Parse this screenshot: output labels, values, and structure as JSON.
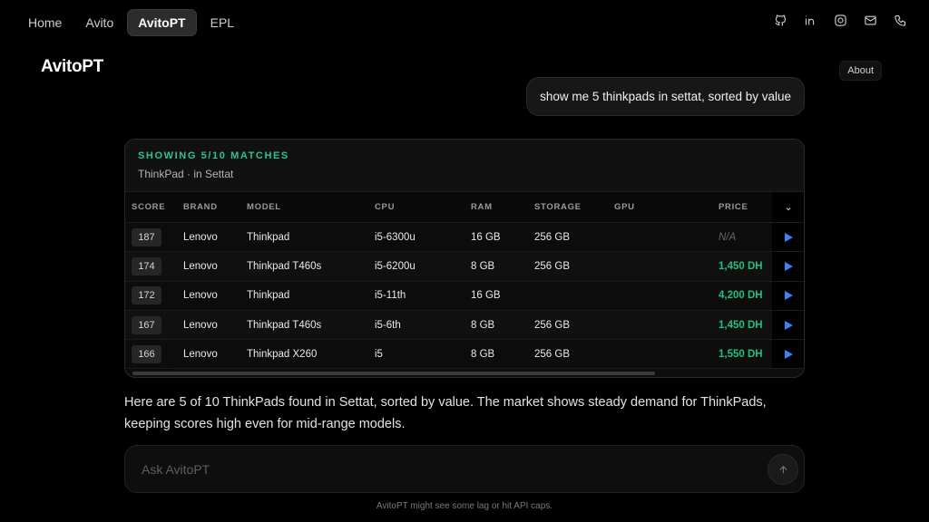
{
  "nav": [
    "Home",
    "Avito",
    "AvitoPT",
    "EPL"
  ],
  "nav_active": 2,
  "socials": [
    "github-icon",
    "linkedin-icon",
    "instagram-icon",
    "mail-icon",
    "phone-icon"
  ],
  "brand": "AvitoPT",
  "about_label": "About",
  "user_message": "show me 5 thinkpads in settat, sorted by value",
  "results": {
    "title": "SHOWING 5/10 MATCHES",
    "subtitle": "ThinkPad · in Settat",
    "columns": [
      "SCORE",
      "BRAND",
      "MODEL",
      "CPU",
      "RAM",
      "STORAGE",
      "GPU",
      "PRICE"
    ],
    "rows": [
      {
        "score": "187",
        "brand": "Lenovo",
        "model": "Thinkpad",
        "cpu": "i5-6300u",
        "ram": "16 GB",
        "storage": "256 GB",
        "gpu": "",
        "price": "N/A"
      },
      {
        "score": "174",
        "brand": "Lenovo",
        "model": "Thinkpad T460s",
        "cpu": "i5-6200u",
        "ram": "8 GB",
        "storage": "256 GB",
        "gpu": "",
        "price": "1,450 DH"
      },
      {
        "score": "172",
        "brand": "Lenovo",
        "model": "Thinkpad",
        "cpu": "i5-11th",
        "ram": "16 GB",
        "storage": "",
        "gpu": "",
        "price": "4,200 DH"
      },
      {
        "score": "167",
        "brand": "Lenovo",
        "model": "Thinkpad T460s",
        "cpu": "i5-6th",
        "ram": "8 GB",
        "storage": "256 GB",
        "gpu": "",
        "price": "1,450 DH"
      },
      {
        "score": "166",
        "brand": "Lenovo",
        "model": "Thinkpad X260",
        "cpu": "i5",
        "ram": "8 GB",
        "storage": "256 GB",
        "gpu": "",
        "price": "1,550 DH"
      }
    ],
    "accent": "#2fc38b",
    "play_color": "#3b82f6"
  },
  "answer": "Here are 5 of 10 ThinkPads found in Settat, sorted by value. The market shows steady demand for ThinkPads, keeping scores high even for mid-range models.",
  "composer": {
    "placeholder": "Ask AvitoPT"
  },
  "footnote": "AvitoPT might see some lag or hit API caps."
}
